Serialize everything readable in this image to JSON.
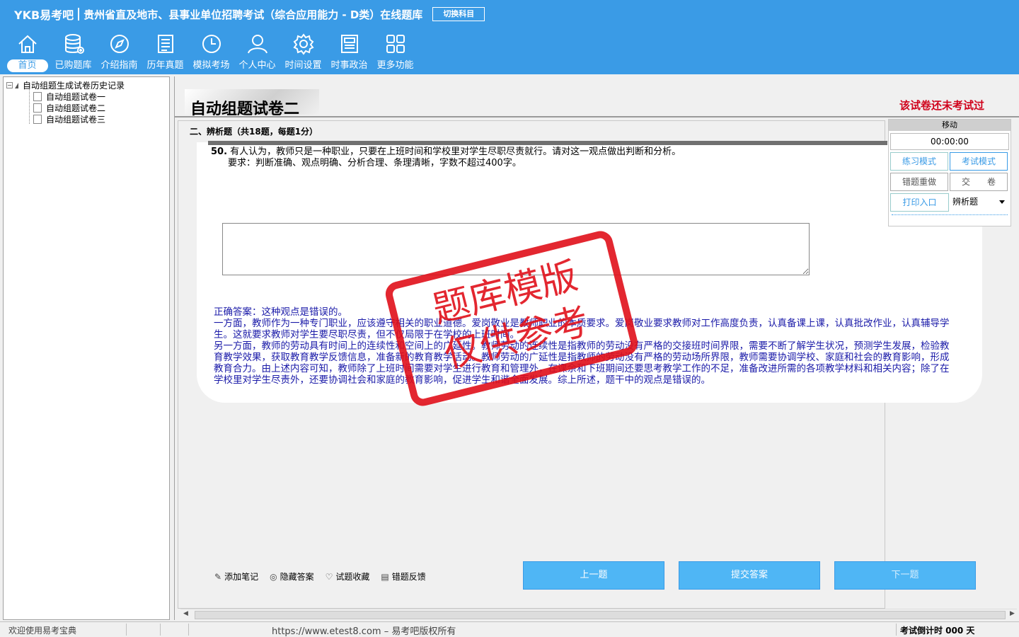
{
  "header": {
    "logo": "YKB易考吧",
    "title": "贵州省直及地市、县事业单位招聘考试（综合应用能力 - D类）在线题库",
    "switch_label": "切换科目",
    "nav": [
      {
        "label": "首页",
        "icon": "home-icon"
      },
      {
        "label": "已购题库",
        "icon": "database-icon"
      },
      {
        "label": "介绍指南",
        "icon": "compass-icon"
      },
      {
        "label": "历年真题",
        "icon": "list-icon"
      },
      {
        "label": "模拟考场",
        "icon": "clock-icon"
      },
      {
        "label": "个人中心",
        "icon": "user-icon"
      },
      {
        "label": "时间设置",
        "icon": "gear-icon"
      },
      {
        "label": "时事政治",
        "icon": "newspaper-icon"
      },
      {
        "label": "更多功能",
        "icon": "grid-icon"
      }
    ]
  },
  "tree": {
    "root": "自动组题生成试卷历史记录",
    "children": [
      "自动组题试卷一",
      "自动组题试卷二",
      "自动组题试卷三"
    ]
  },
  "paper": {
    "title": "自动组题试卷二",
    "status": "该试卷还未考试过",
    "section": "二、辨析题（共18题，每题1分）",
    "question_num": "50.",
    "question_text": "有人认为，教师只是一种职业，只要在上班时间和学校里对学生尽职尽责就行。请对这一观点做出判断和分析。",
    "question_req": "要求：判断准确、观点明确、分析合理、条理清晰，字数不超过400字。",
    "answer_lines": [
      "正确答案：这种观点是错误的。",
      "一方面，教师作为一种专门职业，应该遵守相关的职业道德。爱岗敬业是教师职业的本质要求。爱岗敬业要求教师对工作高度负责，认真备课上课，认真批改作业，认真辅导学生。这就要求教师对学生要尽职尽责，但不仅局限于在学校的上班时间。",
      "另一方面，教师的劳动具有时间上的连续性和空间上的广延性。教师劳动的连续性是指教师的劳动没有严格的交接班时间界限，需要不断了解学生状况，预测学生发展，检验教育教学效果，获取教育教学反馈信息，准备新的教育教学活动。教师劳动的广延性是指教师的劳动没有严格的劳动场所界限，教师需要协调学校、家庭和社会的教育影响，形成教育合力。由上述内容可知，教师除了上班时间需要对学生进行教育和管理外，在课余和下班期间还要思考教学工作的不足，准备改进所需的各项教学材料和相关内容；除了在学校里对学生尽责外，还要协调社会和家庭的教育影响，促进学生和谐全面发展。综上所述，题干中的观点是错误的。"
    ],
    "stamp_line1": "题库模版",
    "stamp_line2": "仅供参考"
  },
  "control": {
    "head": "移动",
    "timer": "00:00:00",
    "practice_mode": "练习模式",
    "exam_mode": "考试模式",
    "redo": "错题重做",
    "submit_paper": "交　　卷",
    "print": "打印入口",
    "type_select": "辨析题"
  },
  "tools": {
    "note": "添加笔记",
    "hide_answer": "隐藏答案",
    "favorite": "试题收藏",
    "feedback": "错题反馈"
  },
  "buttons": {
    "prev": "上一题",
    "submit": "提交答案",
    "next": "下一题"
  },
  "statusbar": {
    "welcome": "欢迎使用易考宝典",
    "copyright": "https://www.etest8.com – 易考吧版权所有",
    "countdown": "考试倒计时 000 天"
  }
}
